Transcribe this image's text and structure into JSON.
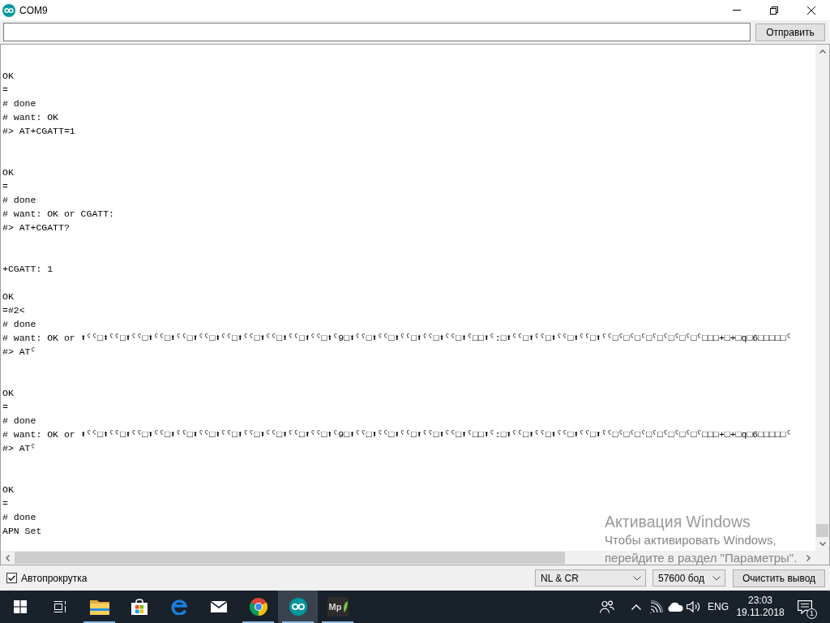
{
  "window": {
    "title": "COM9"
  },
  "send_bar": {
    "button": "Отправить"
  },
  "output": {
    "lines": [
      {
        "kind": "blank"
      },
      {
        "kind": "blank"
      },
      {
        "kind": "text",
        "text": "OK"
      },
      {
        "kind": "text",
        "text": "="
      },
      {
        "kind": "text",
        "text": "# done"
      },
      {
        "kind": "text",
        "text": "# want: OK"
      },
      {
        "kind": "text",
        "text": "#> AT+CGATT=1"
      },
      {
        "kind": "blank"
      },
      {
        "kind": "blank"
      },
      {
        "kind": "text",
        "text": "OK"
      },
      {
        "kind": "text",
        "text": "="
      },
      {
        "kind": "text",
        "text": "# done"
      },
      {
        "kind": "text",
        "text": "# want: OK or CGATT:"
      },
      {
        "kind": "text",
        "text": "#> AT+CGATT?"
      },
      {
        "kind": "blank"
      },
      {
        "kind": "blank"
      },
      {
        "kind": "text",
        "text": "+CGATT: 1"
      },
      {
        "kind": "blank"
      },
      {
        "kind": "text",
        "text": "OK"
      },
      {
        "kind": "text",
        "text": "=#2<"
      },
      {
        "kind": "text",
        "text": "# done"
      },
      {
        "kind": "text",
        "text": "# want: OK or ⬆ˁˁ□⬆ˁˁ□⬆ˁˁ□⬆ˁˁ□⬆ˁˁ□⬆ˁˁ□⬆ˁˁ□⬆ˁˁ□⬆ˁˁ□⬆ˁˁ□⬆ˁˁ□⬆ˁ9□⬆ˁˁ□⬆ˁˁ□⬆ˁˁ□⬆ˁˁ□⬆ˁˁ□⬆ˁ□□⬆ˁ:□⬆ˁˁ□⬆ˁˁ□⬆ˁˁ□⬆ˁˁ□⬆ˁˁ□ˁ□ˁ□ˁ□ˁ□ˁ□ˁ□ˁ□ˁ□□□+□+□q□6□□□□□ˁ"
      },
      {
        "kind": "text",
        "text": "#> ATˁ"
      },
      {
        "kind": "blank"
      },
      {
        "kind": "blank"
      },
      {
        "kind": "text",
        "text": "OK"
      },
      {
        "kind": "text",
        "text": "="
      },
      {
        "kind": "text",
        "text": "# done"
      },
      {
        "kind": "text",
        "text": "# want: OK or ⬆ˁˁ□⬆ˁˁ□⬆ˁˁ□⬆ˁˁ□⬆ˁˁ□⬆ˁˁ□⬆ˁˁ□⬆ˁˁ□⬆ˁˁ□⬆ˁˁ□⬆ˁˁ□⬆ˁ9□⬆ˁˁ□⬆ˁˁ□⬆ˁˁ□⬆ˁˁ□⬆ˁˁ□⬆ˁ□□⬆ˁ:□⬆ˁˁ□⬆ˁˁ□⬆ˁˁ□⬆ˁˁ□⬆ˁˁ□ˁ□ˁ□ˁ□ˁ□ˁ□ˁ□ˁ□ˁ□□□+□+□q□6□□□□□ˁ"
      },
      {
        "kind": "text",
        "text": "#> ATˁ"
      },
      {
        "kind": "blank"
      },
      {
        "kind": "blank"
      },
      {
        "kind": "text",
        "text": "OK"
      },
      {
        "kind": "text",
        "text": "="
      },
      {
        "kind": "text",
        "text": "# done"
      },
      {
        "kind": "text",
        "text": "APN Set"
      }
    ]
  },
  "footer": {
    "autoscroll": {
      "label": "Автопрокрутка",
      "checked": true
    },
    "line_ending": "NL & CR",
    "baud_rate": "57600 бод",
    "clear_button": "Очистить вывод"
  },
  "activation_notice": {
    "title": "Активация Windows",
    "lines": [
      "Чтобы активировать Windows,",
      "перейдите в раздел \"Параметры\"."
    ]
  },
  "taskbar": {
    "buttons": [
      {
        "kind": "start",
        "running": false,
        "selected": false
      },
      {
        "kind": "task_view",
        "running": false,
        "selected": false
      },
      {
        "kind": "explorer",
        "running": true,
        "selected": false
      },
      {
        "kind": "store",
        "running": false,
        "selected": false
      },
      {
        "kind": "edge",
        "running": false,
        "selected": false
      },
      {
        "kind": "mail",
        "running": false,
        "selected": false
      },
      {
        "kind": "chrome",
        "running": true,
        "selected": false
      },
      {
        "kind": "arduino",
        "running": true,
        "selected": true
      },
      {
        "kind": "mp",
        "label": "Mp",
        "running": true,
        "selected": false
      }
    ],
    "tray": {
      "language": "ENG",
      "time": "23:03",
      "date": "19.11.2018",
      "notifications": "1"
    }
  }
}
